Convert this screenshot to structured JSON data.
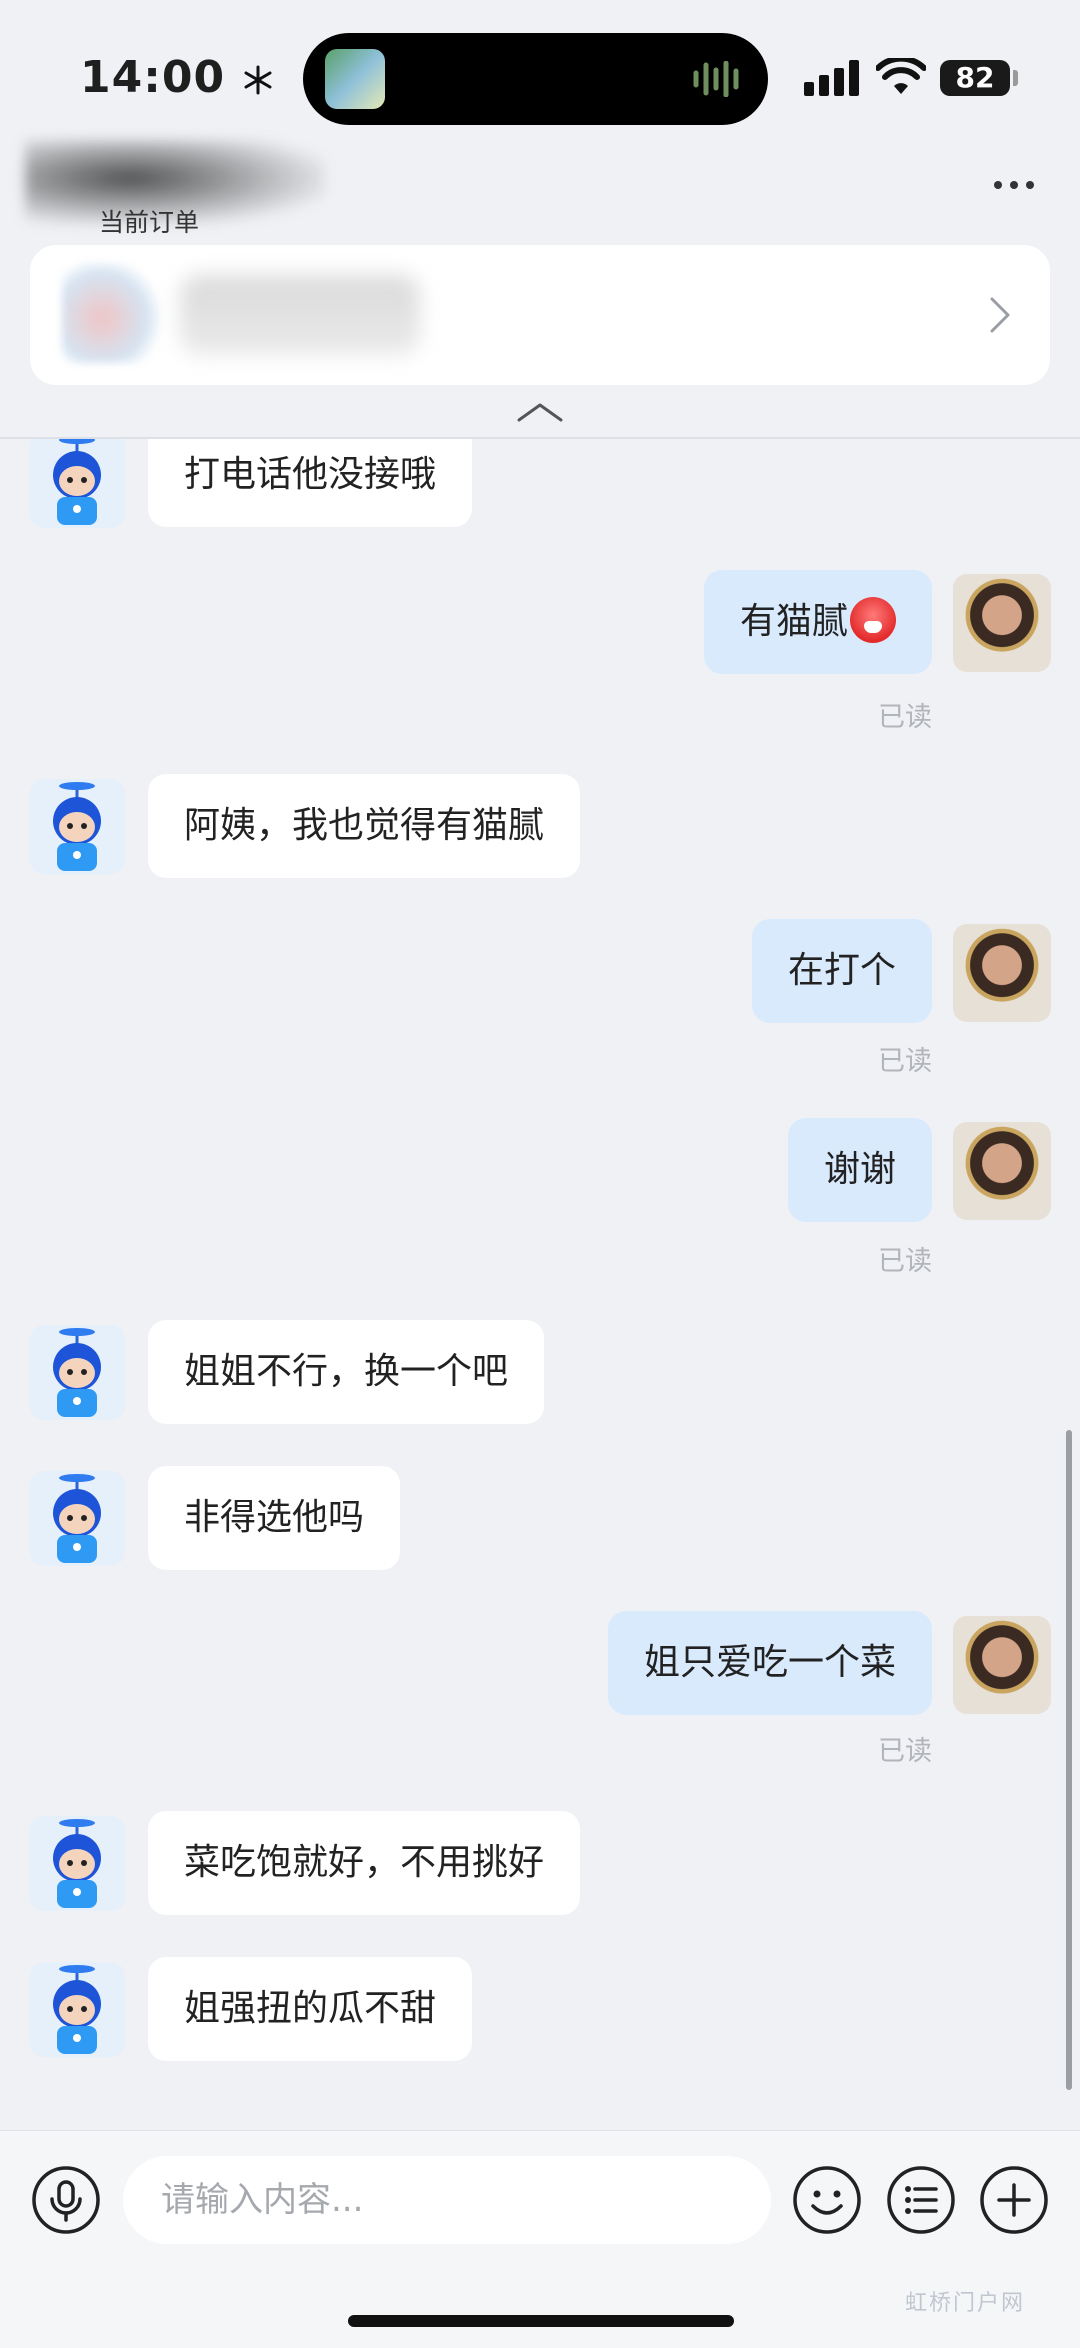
{
  "status_bar": {
    "time": "14:00",
    "time_icon": "snowflake-icon",
    "battery": "82"
  },
  "header": {
    "current_order_label": "当前订单",
    "menu_icon": "more-icon"
  },
  "messages": [
    {
      "side": "in",
      "text": "打电话他没接哦"
    },
    {
      "side": "out",
      "text": "有猫腻",
      "emoji": "angry-face-icon",
      "status": "已读"
    },
    {
      "side": "in",
      "text": "阿姨，我也觉得有猫腻"
    },
    {
      "side": "out",
      "text": "在打个",
      "status": "已读"
    },
    {
      "side": "out",
      "text": "谢谢",
      "status": "已读"
    },
    {
      "side": "in",
      "text": "姐姐不行，换一个吧"
    },
    {
      "side": "in",
      "text": "非得选他吗"
    },
    {
      "side": "out",
      "text": "姐只爱吃一个菜",
      "status": "已读"
    },
    {
      "side": "in",
      "text": "菜吃饱就好，不用挑好"
    },
    {
      "side": "in",
      "text": "姐强扭的瓜不甜"
    }
  ],
  "input_bar": {
    "placeholder": "请输入内容...",
    "voice_icon": "microphone-icon",
    "emoji_icon": "smiley-icon",
    "menu_icon": "list-icon",
    "add_icon": "plus-icon"
  },
  "watermark": "虹桥门户网"
}
